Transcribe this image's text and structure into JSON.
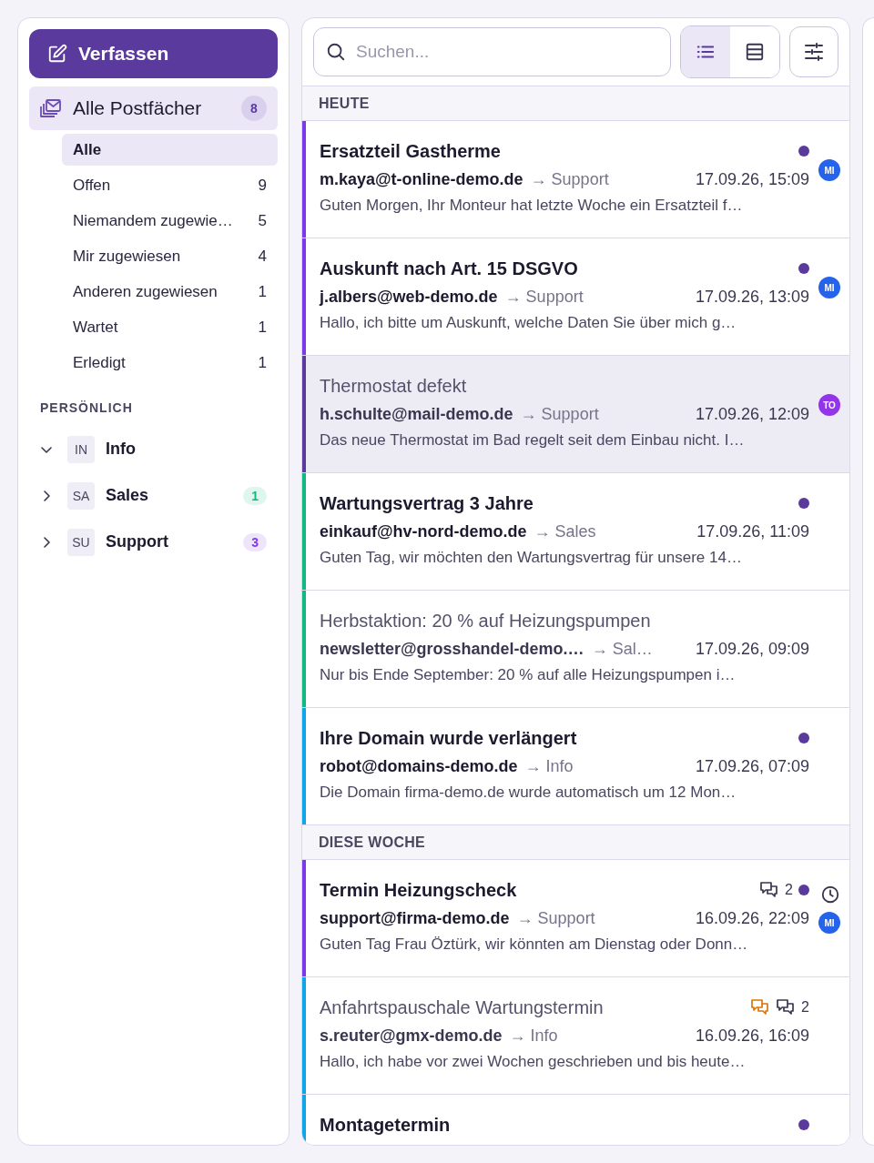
{
  "sidebar": {
    "compose_button": "Verfassen",
    "all_mailboxes": {
      "label": "Alle Postfächer",
      "count": "8",
      "selected": true
    },
    "filters": [
      {
        "label": "Alle",
        "selected": true
      },
      {
        "label": "Offen",
        "count": "9",
        "selected": false
      },
      {
        "label": "Niemandem zugewie…",
        "count": "5",
        "selected": false
      },
      {
        "label": "Mir zugewiesen",
        "count": "4",
        "selected": false
      },
      {
        "label": "Anderen zugewiesen",
        "count": "1",
        "selected": false
      },
      {
        "label": "Wartet",
        "count": "1",
        "selected": false
      },
      {
        "label": "Erledigt",
        "count": "1",
        "selected": false
      }
    ],
    "section_title": "PERSÖNLICH",
    "mailboxes": [
      {
        "initials": "IN",
        "name": "Info",
        "expanded": true
      },
      {
        "initials": "SA",
        "name": "Sales",
        "expanded": false,
        "badge": "1",
        "color": "#10b981"
      },
      {
        "initials": "SU",
        "name": "Support",
        "expanded": false,
        "badge": "3",
        "color": "#7c3aed"
      }
    ]
  },
  "toolbar": {
    "search": {
      "placeholder": "Suchen..."
    },
    "views": [
      {
        "kind": "list",
        "selected": true
      },
      {
        "kind": "table",
        "selected": false
      }
    ]
  },
  "groups": [
    {
      "title": "HEUTE",
      "messages": [
        {
          "subject": "Ersatzteil Gastherme",
          "unread": true,
          "selected": false,
          "color": "#7c3aed",
          "sender": "m.kaya@t-online-demo.de",
          "mailbox": "→ Support",
          "date": "17.09.26, 15:09",
          "preview": "Guten Morgen, Ihr Monteur hat letzte Woche ein Ersatzteil f…",
          "avatar": {
            "initials": "MI",
            "color": "#2563eb"
          }
        },
        {
          "subject": "Auskunft nach Art. 15 DSGVO",
          "unread": true,
          "selected": false,
          "color": "#7c3aed",
          "sender": "j.albers@web-demo.de",
          "mailbox": "→ Support",
          "date": "17.09.26, 13:09",
          "preview": "Hallo, ich bitte um Auskunft, welche Daten Sie über mich g…",
          "avatar": {
            "initials": "MI",
            "color": "#2563eb"
          }
        },
        {
          "subject": "Thermostat defekt",
          "unread": false,
          "selected": true,
          "color": "#5b3a9e",
          "sender": "h.schulte@mail-demo.de",
          "mailbox": "→ Support",
          "date": "17.09.26, 12:09",
          "preview": "Das neue Thermostat im Bad regelt seit dem Einbau nicht. I…",
          "avatar": {
            "initials": "TO",
            "color": "#9333ea"
          }
        },
        {
          "subject": "Wartungsvertrag 3 Jahre",
          "unread": true,
          "selected": false,
          "color": "#10b981",
          "sender": "einkauf@hv-nord-demo.de",
          "mailbox": "→ Sales",
          "date": "17.09.26, 11:09",
          "preview": "Guten Tag, wir möchten den Wartungsvertrag für unsere 14…"
        },
        {
          "subject": "Herbstaktion: 20 % auf Heizungspumpen",
          "unread": false,
          "selected": false,
          "color": "#10b981",
          "sender": "newsletter@grosshandel-demo.…",
          "mailbox": "→ Sal…",
          "date": "17.09.26, 09:09",
          "preview": "Nur bis Ende September: 20 % auf alle Heizungspumpen i…"
        },
        {
          "subject": "Ihre Domain wurde verlängert",
          "unread": true,
          "selected": false,
          "color": "#0ea5e9",
          "sender": "robot@domains-demo.de",
          "mailbox": "→ Info",
          "date": "17.09.26, 07:09",
          "preview": "Die Domain firma-demo.de wurde automatisch um 12 Mon…"
        }
      ]
    },
    {
      "title": "DIESE WOCHE",
      "messages": [
        {
          "subject": "Termin Heizungscheck",
          "unread": true,
          "selected": false,
          "color": "#7c3aed",
          "comments": "2",
          "waiting": true,
          "sender": "support@firma-demo.de",
          "mailbox": "→ Support",
          "date": "16.09.26, 22:09",
          "preview": "Guten Tag Frau Öztürk, wir könnten am Dienstag oder Donn…",
          "avatar": {
            "initials": "MI",
            "color": "#2563eb"
          }
        },
        {
          "subject": "Anfahrtspauschale Wartungstermin",
          "unread": false,
          "selected": false,
          "color": "#0ea5e9",
          "internal_note": true,
          "comments": "2",
          "sender": "s.reuter@gmx-demo.de",
          "mailbox": "→ Info",
          "date": "16.09.26, 16:09",
          "preview": "Hallo, ich habe vor zwei Wochen geschrieben und bis heute…"
        },
        {
          "subject": "Montagetermin",
          "unread": true,
          "selected": false,
          "color": "#0ea5e9"
        }
      ]
    }
  ]
}
